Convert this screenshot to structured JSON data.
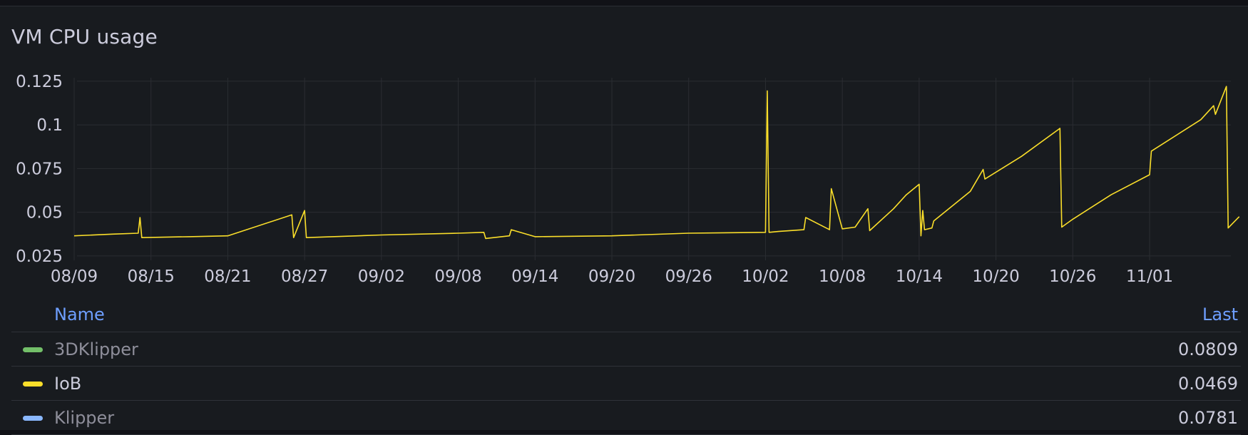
{
  "panel": {
    "title": "VM CPU usage"
  },
  "legend": {
    "header_name": "Name",
    "header_last": "Last",
    "rows": [
      {
        "name": "3DKlipper",
        "last": "0.0809",
        "color": "#73bf69",
        "dimmed": true
      },
      {
        "name": "IoB",
        "last": "0.0469",
        "color": "#fade2a",
        "dimmed": false
      },
      {
        "name": "Klipper",
        "last": "0.0781",
        "color": "#8ab8ff",
        "dimmed": true
      }
    ]
  },
  "chart_data": {
    "type": "line",
    "title": "VM CPU usage",
    "xlabel": "",
    "ylabel": "",
    "x_tick_labels": [
      "08/09",
      "08/15",
      "08/21",
      "08/27",
      "09/02",
      "09/08",
      "09/14",
      "09/20",
      "09/26",
      "10/02",
      "10/08",
      "10/14",
      "10/20",
      "10/26",
      "11/01"
    ],
    "y_tick_labels": [
      "0.025",
      "0.05",
      "0.075",
      "0.1",
      "0.125"
    ],
    "ylim": [
      0.0225,
      0.127
    ],
    "grid": true,
    "legend_placement": "bottom",
    "series": [
      {
        "name": "IoB",
        "color": "#fade2a",
        "x": [
          "08/09",
          "08/12",
          "08/14",
          "08/14",
          "08/14",
          "08/18",
          "08/21",
          "08/26",
          "08/26",
          "08/27",
          "08/27",
          "09/02",
          "09/08",
          "09/10",
          "09/10",
          "09/12",
          "09/12",
          "09/14",
          "09/20",
          "09/26",
          "10/02",
          "10/02",
          "10/02",
          "10/03",
          "10/05",
          "10/05",
          "10/07",
          "10/07",
          "10/08",
          "10/09",
          "10/10",
          "10/10",
          "10/12",
          "10/13",
          "10/14",
          "10/14",
          "10/14",
          "10/14",
          "10/15",
          "10/15",
          "10/18",
          "10/19",
          "10/19",
          "10/22",
          "10/25",
          "10/25",
          "10/26",
          "10/29",
          "11/01",
          "11/01",
          "11/05",
          "11/06",
          "11/06",
          "11/07",
          "11/07",
          "11/08"
        ],
        "y": [
          0.0365,
          0.0375,
          0.038,
          0.047,
          0.0355,
          0.036,
          0.0365,
          0.0485,
          0.0355,
          0.051,
          0.0355,
          0.037,
          0.038,
          0.0385,
          0.035,
          0.0365,
          0.04,
          0.036,
          0.0365,
          0.038,
          0.0385,
          0.1195,
          0.0385,
          0.039,
          0.04,
          0.047,
          0.04,
          0.0635,
          0.0405,
          0.0415,
          0.052,
          0.0395,
          0.052,
          0.06,
          0.066,
          0.0365,
          0.051,
          0.04,
          0.041,
          0.045,
          0.062,
          0.0745,
          0.069,
          0.082,
          0.098,
          0.0415,
          0.046,
          0.06,
          0.0715,
          0.085,
          0.103,
          0.111,
          0.106,
          0.122,
          0.041,
          0.0475
        ]
      }
    ]
  }
}
